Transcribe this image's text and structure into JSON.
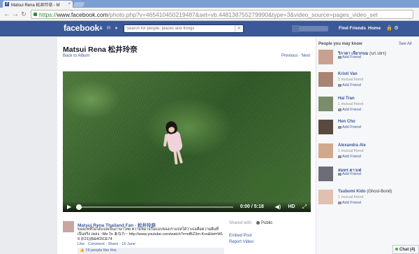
{
  "browser": {
    "tab_title": "Matsui Rena 松井玲奈 - M",
    "tab_close": "×",
    "url_scheme": "https://",
    "url_host": "www.facebook.com",
    "url_rest": "/photo.php?v=465410450219487&set=vb.448138755279990&type=3&video_source=pages_video_set",
    "back_glyph": "←",
    "forward_glyph": "→",
    "reload_glyph": "↻"
  },
  "fb": {
    "logo": "facebook",
    "search_placeholder": "Search for people, places and things",
    "search_glyph": "⌕",
    "nav_find_friends": "Find Friends",
    "nav_home": "Home",
    "icons": [
      "friend-requests-icon",
      "messages-icon",
      "notifications-icon",
      "privacy-shortcuts-icon",
      "account-settings-icon"
    ]
  },
  "album": {
    "title": "Matsui Rena 松井玲奈",
    "back_link": "Back to Album",
    "prev_next": "Previous · Next"
  },
  "video": {
    "play_glyph": "▶",
    "time": "0:00 / 5:18",
    "volume_glyph": "◀)",
    "hd_label": "HD",
    "fullscreen_glyph": "⤢",
    "progress_fraction": 0.0
  },
  "post": {
    "poster_name": "Matsui Rena Thailand Fan - 松井玲奈",
    "text": "ขออภัยที่ไม่ได้แปลเป็นภาษาไทย ความหมายในแบบของเราแปลได้ว่าเธอคือความฝันที่เป็นจริง เพลง ~Me To あなた~ http://www.youtube.com/watch?v=elBZ3m-Kvs&list=WL 9 (F21)(B&4OICE74",
    "actions": "Like · Comment · Share · 15 June",
    "likes": "19 people like this."
  },
  "sharing": {
    "shared_with": "Shared with:",
    "audience": "Public",
    "embed": "Embed Post",
    "report": "Report Video"
  },
  "sidebar": {
    "title": "People you may know",
    "see_all": "See All",
    "people": [
      {
        "name": "วิกาดา เจียวกนม",
        "sub": "(นร.ปลร)",
        "mutual": "",
        "add": "Add Friend"
      },
      {
        "name": "Kristi Van",
        "sub": "",
        "mutual": "1 mutual friend",
        "add": "Add Friend"
      },
      {
        "name": "Hai Tran",
        "sub": "",
        "mutual": "1 mutual friend",
        "add": "Add Friend"
      },
      {
        "name": "Hen Cho",
        "sub": "",
        "mutual": "",
        "add": "Add Friend"
      },
      {
        "name": "Alexandra Ale",
        "sub": "",
        "mutual": "1 mutual friend",
        "add": "Add Friend"
      },
      {
        "name": "สมทร ดาวเพ่",
        "sub": "",
        "mutual": "",
        "add": "Add Friend"
      },
      {
        "name": "Tsubomi Kido",
        "sub": "(Ghost-Bond)",
        "mutual": "1 mutual friend",
        "add": "Add Friend"
      }
    ]
  },
  "chat": {
    "label": "Chat (4)"
  }
}
